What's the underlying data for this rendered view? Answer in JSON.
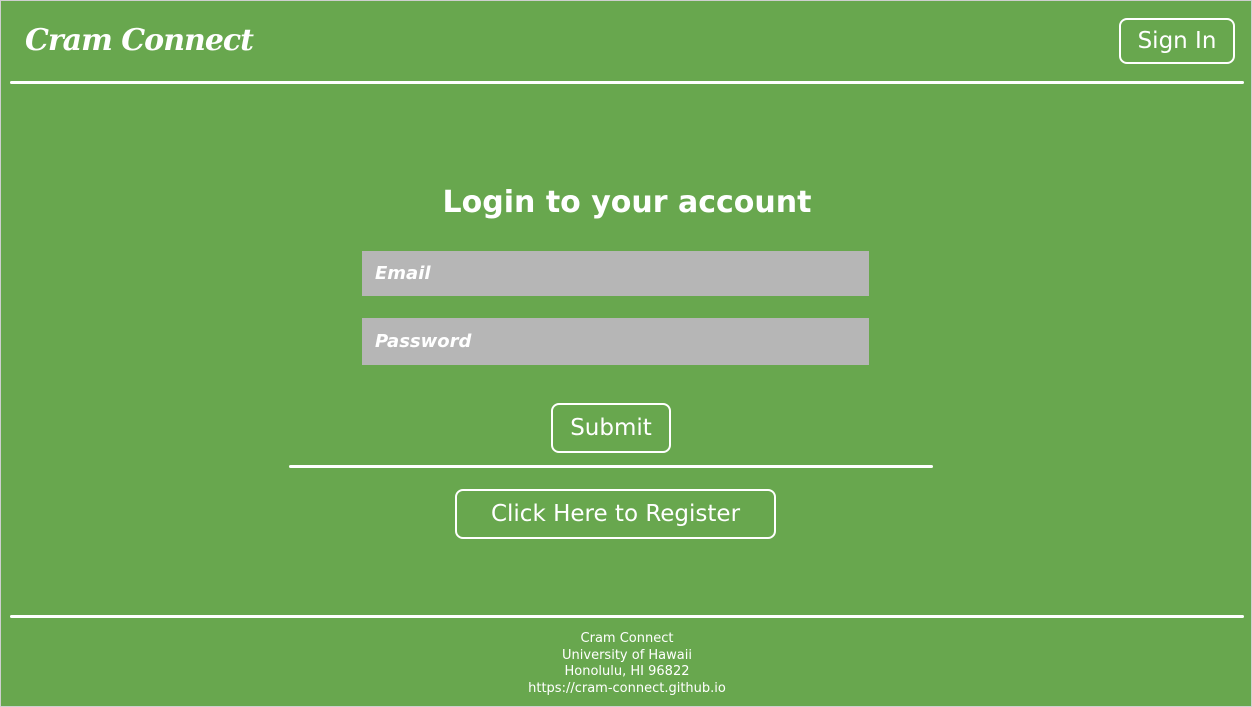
{
  "header": {
    "brand": "Cram Connect",
    "signin_label": "Sign In"
  },
  "form": {
    "title": "Login to your account",
    "email_placeholder": "Email",
    "password_placeholder": "Password",
    "submit_label": "Submit",
    "register_label": "Click Here to Register"
  },
  "footer": {
    "lines": [
      "Cram Connect",
      "University of Hawaii",
      "Honolulu, HI 96822",
      "https://cram-connect.github.io"
    ]
  },
  "colors": {
    "background": "#68a74e",
    "input_fill": "#b6b6b6",
    "text": "#ffffff"
  }
}
